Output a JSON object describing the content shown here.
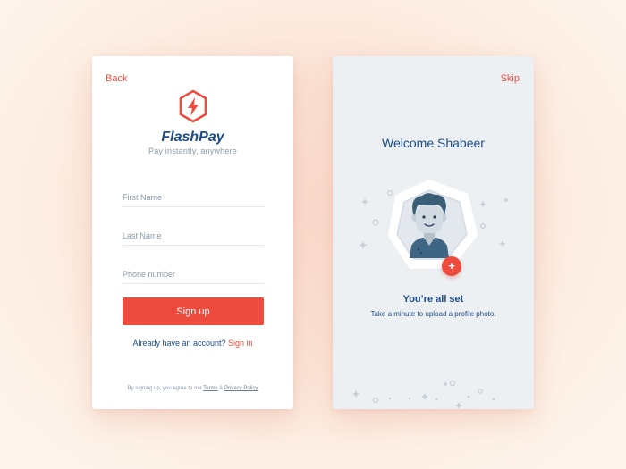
{
  "signup_screen": {
    "back_label": "Back",
    "brand_name": "FlashPay",
    "tagline": "Pay instantly, anywhere",
    "fields": {
      "first_name_placeholder": "First Name",
      "last_name_placeholder": "Last Name",
      "phone_placeholder": "Phone number"
    },
    "signup_button": "Sign up",
    "have_account_text": "Already have an account?",
    "signin_link": "Sign in",
    "terms_prefix": "By signing up, you agree to our",
    "terms_link": "Terms",
    "terms_and": "&",
    "privacy_link": "Privacy Policy"
  },
  "welcome_screen": {
    "skip_label": "Skip",
    "title": "Welcome Shabeer",
    "add_photo_icon": "plus-icon",
    "status_title": "You’re all set",
    "status_sub": "Take a minute to upload a profile photo."
  },
  "colors": {
    "accent": "#ee4b3f",
    "brand_navy": "#1d4d86",
    "muted": "#8a9aab",
    "welcome_bg": "#edf0f3"
  }
}
